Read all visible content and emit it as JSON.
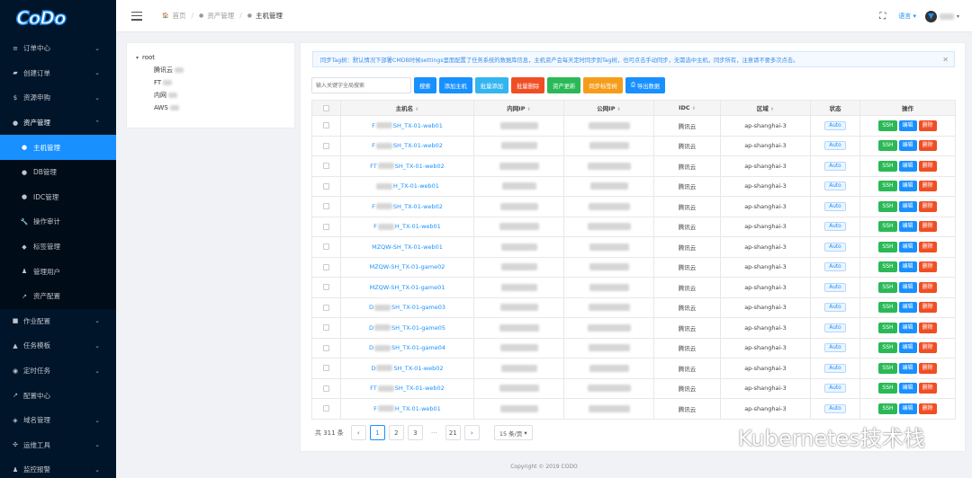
{
  "logo": {
    "text": "CoDo"
  },
  "sidebar": {
    "items": [
      {
        "label": "订单中心",
        "icon": "list-icon",
        "expandable": true
      },
      {
        "label": "创建订单",
        "icon": "cart-icon",
        "expandable": true
      },
      {
        "label": "资源申购",
        "icon": "dollar-icon",
        "expandable": true
      },
      {
        "label": "资产管理",
        "icon": "asset-icon",
        "expandable": true,
        "open": true
      },
      {
        "label": "主机管理",
        "icon": "host-icon",
        "sub": true,
        "active": true
      },
      {
        "label": "DB管理",
        "icon": "db-icon",
        "sub": true
      },
      {
        "label": "IDC管理",
        "icon": "idc-icon",
        "sub": true
      },
      {
        "label": "操作审计",
        "icon": "wrench-icon",
        "sub": true
      },
      {
        "label": "标签管理",
        "icon": "tag-icon",
        "sub": true
      },
      {
        "label": "管理用户",
        "icon": "user-icon",
        "sub": true
      },
      {
        "label": "资产配置",
        "icon": "config-icon",
        "sub": true
      },
      {
        "label": "作业配置",
        "icon": "job-icon",
        "expandable": true
      },
      {
        "label": "任务模板",
        "icon": "template-icon",
        "expandable": true
      },
      {
        "label": "定时任务",
        "icon": "timer-icon",
        "expandable": true
      },
      {
        "label": "配置中心",
        "icon": "config-center-icon",
        "expandable": false
      },
      {
        "label": "域名管理",
        "icon": "domain-icon",
        "expandable": true
      },
      {
        "label": "运维工具",
        "icon": "tools-icon",
        "expandable": true
      },
      {
        "label": "监控报警",
        "icon": "alarm-icon",
        "expandable": true
      }
    ]
  },
  "header": {
    "breadcrumb": [
      "首页",
      "资产管理",
      "主机管理"
    ],
    "lang_label": "语言"
  },
  "tree": {
    "root": "root",
    "children": [
      "腾讯云",
      "FT",
      "内网",
      "AWS"
    ]
  },
  "alert": {
    "text": "同步Tag树：默认情况下部署CMDB时候settings里面配置了任务系统的数据库信息，主机资产会每天定时同步到Tag树，也可点击手动同步，无需选中主机，同步所有，注意请不要多次点击。"
  },
  "toolbar": {
    "search_placeholder": "输入关键字全局搜索",
    "buttons": [
      {
        "label": "搜索",
        "color": "#1890ff"
      },
      {
        "label": "添加主机",
        "color": "#1890ff"
      },
      {
        "label": "批量添加",
        "color": "#33b5f0"
      },
      {
        "label": "批量删除",
        "color": "#f04e24"
      },
      {
        "label": "资产更新",
        "color": "#2ab956"
      },
      {
        "label": "同步标签树",
        "color": "#f59d1a"
      },
      {
        "label": "导出数据",
        "color": "#1890ff"
      }
    ]
  },
  "table": {
    "headers": [
      "主机名",
      "内网IP",
      "公网IP",
      "IDC",
      "区域",
      "状态",
      "操作"
    ],
    "rows": [
      {
        "host_prefix": "F",
        "host_suffix": "SH_TX-01-web01",
        "idc": "腾讯云",
        "region": "ap-shanghai-3",
        "status": "Auto"
      },
      {
        "host_prefix": "F",
        "host_suffix": "SH_TX-01-web02",
        "idc": "腾讯云",
        "region": "ap-shanghai-3",
        "status": "Auto"
      },
      {
        "host_prefix": "FT",
        "host_suffix": "SH_TX-01-web02",
        "idc": "腾讯云",
        "region": "ap-shanghai-3",
        "status": "Auto"
      },
      {
        "host_prefix": "",
        "host_suffix": "H_TX-01-web01",
        "idc": "腾讯云",
        "region": "ap-shanghai-3",
        "status": "Auto"
      },
      {
        "host_prefix": "F",
        "host_suffix": "SH_TX-01-web02",
        "idc": "腾讯云",
        "region": "ap-shanghai-3",
        "status": "Auto"
      },
      {
        "host_prefix": "F",
        "host_suffix": "H_TX-01-web01",
        "idc": "腾讯云",
        "region": "ap-shanghai-3",
        "status": "Auto"
      },
      {
        "host_prefix": "MZQW-SH_TX-01-web01",
        "host_suffix": "",
        "idc": "腾讯云",
        "region": "ap-shanghai-3",
        "status": "Auto"
      },
      {
        "host_prefix": "MZQW-SH_TX-01-game02",
        "host_suffix": "",
        "idc": "腾讯云",
        "region": "ap-shanghai-3",
        "status": "Auto"
      },
      {
        "host_prefix": "MZQW-SH_TX-01-game01",
        "host_suffix": "",
        "idc": "腾讯云",
        "region": "ap-shanghai-3",
        "status": "Auto"
      },
      {
        "host_prefix": "D",
        "host_suffix": "SH_TX-01-game03",
        "idc": "腾讯云",
        "region": "ap-shanghai-3",
        "status": "Auto"
      },
      {
        "host_prefix": "D",
        "host_suffix": "SH_TX-01-game05",
        "idc": "腾讯云",
        "region": "ap-shanghai-3",
        "status": "Auto"
      },
      {
        "host_prefix": "D",
        "host_suffix": "SH_TX-01-game04",
        "idc": "腾讯云",
        "region": "ap-shanghai-3",
        "status": "Auto"
      },
      {
        "host_prefix": "D",
        "host_suffix": "SH_TX-01-web02",
        "idc": "腾讯云",
        "region": "ap-shanghai-3",
        "status": "Auto"
      },
      {
        "host_prefix": "FT",
        "host_suffix": "SH_TX-01-web02",
        "idc": "腾讯云",
        "region": "ap-shanghai-3",
        "status": "Auto"
      },
      {
        "host_prefix": "F",
        "host_suffix": "H_TX-01-web01",
        "idc": "腾讯云",
        "region": "ap-shanghai-3",
        "status": "Auto"
      }
    ],
    "actions": [
      {
        "label": "SSH",
        "color": "#2ab956"
      },
      {
        "label": "编辑",
        "color": "#1890ff"
      },
      {
        "label": "删除",
        "color": "#f04e24"
      }
    ]
  },
  "pagination": {
    "total": "共 311 条",
    "pages": [
      "1",
      "2",
      "3",
      "···",
      "21"
    ],
    "current": "1",
    "page_size": "15 条/页"
  },
  "footer": {
    "text": "Copyright © 2019 CODO"
  },
  "watermark": {
    "text": "Kubernetes技术栈"
  }
}
